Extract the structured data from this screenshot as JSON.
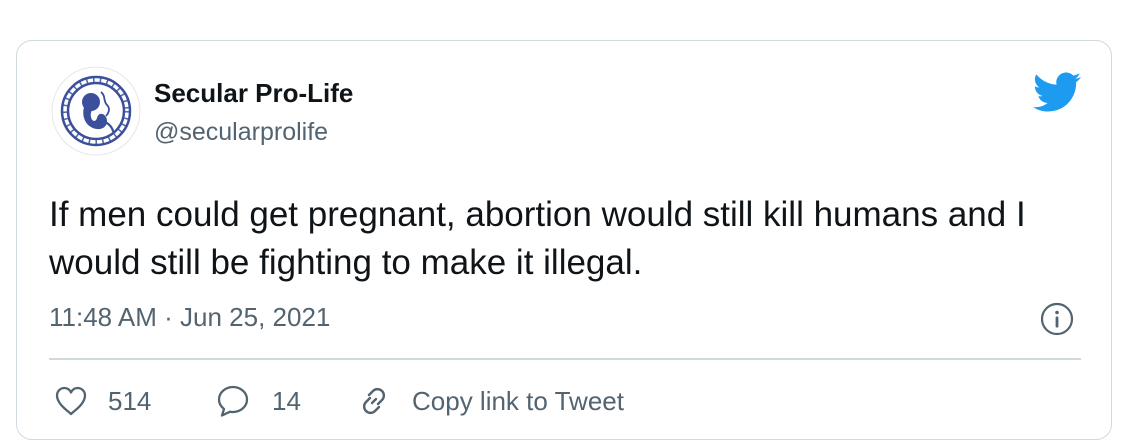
{
  "author": {
    "name": "Secular Pro-Life",
    "handle": "@secularprolife"
  },
  "tweet": {
    "text": "If men could get pregnant, abortion would still kill humans and I would still be fighting to make it illegal.",
    "timestamp": "11:48 AM · Jun 25, 2021"
  },
  "actions": {
    "likes": "514",
    "replies": "14",
    "copy_link_label": "Copy link to Tweet"
  },
  "icons": {
    "brand": "twitter-bird-icon",
    "info": "info-icon",
    "like": "heart-icon",
    "reply": "speech-bubble-icon",
    "copy": "link-icon"
  },
  "colors": {
    "twitter_blue": "#1d9bf0",
    "avatar_blue": "#3b4f9c",
    "text_primary": "#0f1419",
    "text_secondary": "#536471",
    "border": "#cfd9de"
  }
}
